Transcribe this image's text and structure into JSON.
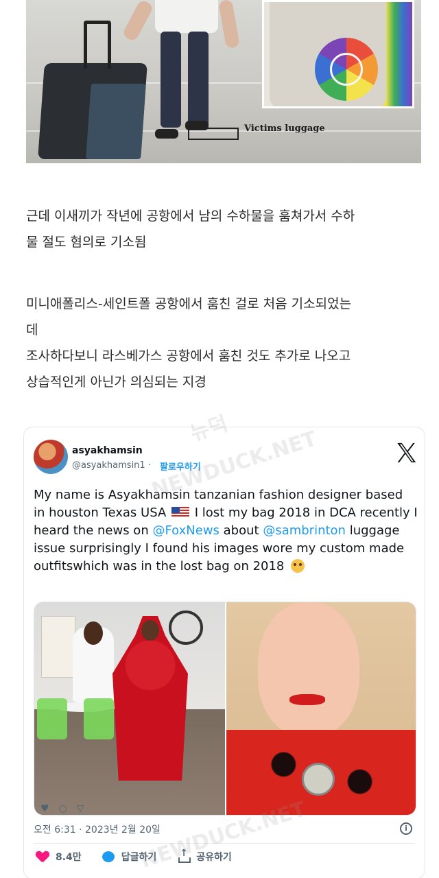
{
  "top_image": {
    "caption": "Victims luggage"
  },
  "korean_paragraphs": [
    {
      "lines": [
        "근데 이새끼가 작년에 공항에서 남의 수하물을 훔쳐가서 수하",
        "물 절도 혐의로 기소됨"
      ]
    },
    {
      "lines": [
        "미니애폴리스-세인트폴 공항에서 훔친 걸로 처음 기소되었는",
        "데",
        "조사하다보니 라스베가스 공항에서 훔친 것도 추가로 나오고",
        "상습적인게 아닌가 의심되는 지경"
      ]
    }
  ],
  "tweet": {
    "display_name": "asyakhamsin",
    "handle": "@asyakhamsin1 ·",
    "follow_label": "팔로우하기",
    "x_logo": "X",
    "text_parts": [
      "My name is Asyakhamsin tanzanian fashion designer based in houston Texas USA ",
      " I lost my bag 2018 in DCA recently I heard the news on ",
      "@FoxNews",
      "  about ",
      "@sambrinton",
      " luggage issue surprisingly I found his images wore my custom made outfitswhich  was in the lost bag on 2018 "
    ],
    "flag_emoji": "us-flag",
    "face_emoji": "pleading-face",
    "timestamp": "오전 6:31 · 2023년 2월 20일",
    "likes": "8.4만",
    "reply_label": "답글하기",
    "share_label": "공유하기",
    "colors": {
      "accent": "#1d9bf0",
      "like": "#f91880"
    }
  },
  "watermarks": [
    "뉴덕",
    "NEWDUCK.NET",
    "NEWDUCK.NET"
  ]
}
